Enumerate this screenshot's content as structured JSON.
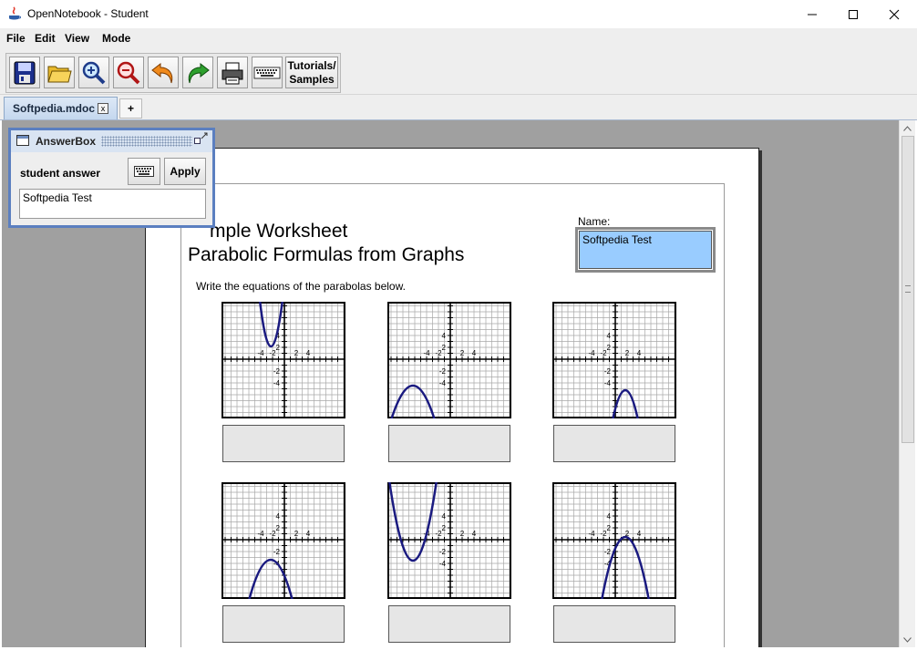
{
  "window": {
    "title": "OpenNotebook - Student"
  },
  "menu": [
    "File",
    "Edit",
    "View",
    "Mode"
  ],
  "toolbar": {
    "tutorials_line1": "Tutorials/",
    "tutorials_line2": "Samples"
  },
  "tabs": {
    "active_label": "Softpedia.mdoc",
    "close_glyph": "x",
    "add_glyph": "+"
  },
  "worksheet": {
    "title_line1": "mple Worksheet",
    "title_line2": "Parabolic Formulas from Graphs",
    "instructions": "Write the equations of the parabolas below.",
    "name_label": "Name:",
    "name_value": "Softpedia Test",
    "tick_labels": {
      "x": [
        "-4",
        "-2",
        "2",
        "4"
      ],
      "y": [
        "4",
        "2",
        "-2",
        "-4"
      ]
    }
  },
  "answerbox": {
    "title": "AnswerBox",
    "label": "student answer",
    "apply_label": "Apply",
    "value": "Softpedia Test"
  },
  "colors": {
    "curve": "#1a1a80",
    "name_box": "#99ccff",
    "answer_window_border": "#5b7fc0"
  }
}
